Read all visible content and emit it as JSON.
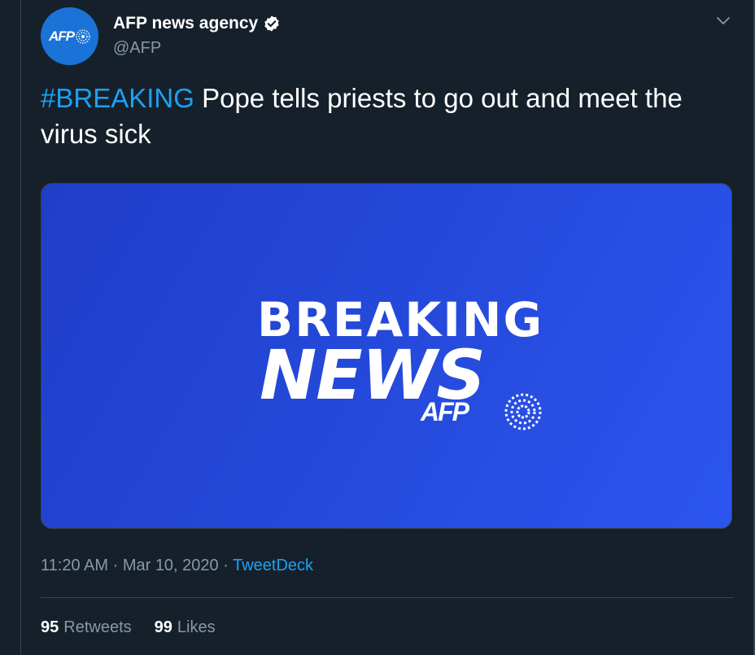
{
  "author": {
    "display_name": "AFP news agency",
    "handle": "@AFP",
    "avatar_logo_text": "AFP",
    "verified": true,
    "avatar_color": "#1a73d6"
  },
  "tweet": {
    "hashtag": "#BREAKING",
    "text": " Pope tells priests to go out and meet the virus sick"
  },
  "media": {
    "line1": "BREAKING",
    "line2": "NEWS",
    "brand": "AFP",
    "background_color": "#2448d8"
  },
  "meta": {
    "time": "11:20 AM",
    "separator": " · ",
    "date": "Mar 10, 2020",
    "source": "TweetDeck"
  },
  "stats": {
    "retweets_count": "95",
    "retweets_label": "Retweets",
    "likes_count": "99",
    "likes_label": "Likes"
  },
  "colors": {
    "background": "#15202b",
    "accent": "#1da1f2",
    "secondary_text": "#8899a6",
    "border": "#38444d"
  },
  "icons": {
    "verified": "verified-badge-icon",
    "caret": "chevron-down-icon"
  }
}
